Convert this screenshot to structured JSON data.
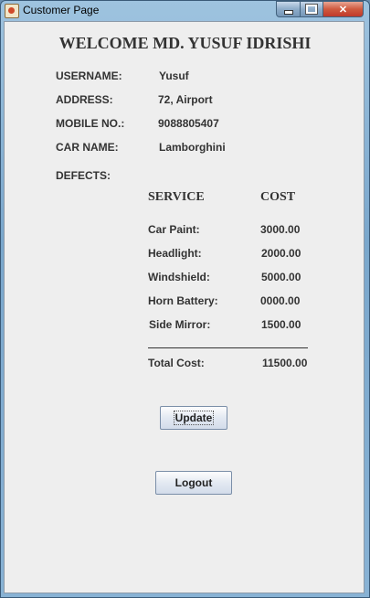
{
  "window": {
    "title": "Customer Page"
  },
  "heading": "WELCOME MD. YUSUF IDRISHI",
  "profile": {
    "username_label": "USERNAME:",
    "username": "Yusuf",
    "address_label": "ADDRESS:",
    "address": "72, Airport",
    "mobile_label": "MOBILE NO.:",
    "mobile": "9088805407",
    "car_label": "CAR NAME:",
    "car": "Lamborghini",
    "defects_label": "DEFECTS:"
  },
  "services": {
    "service_header": "SERVICE",
    "cost_header": "COST",
    "items": [
      {
        "name": "Car Paint:",
        "cost": "3000.00"
      },
      {
        "name": "Headlight:",
        "cost": "2000.00"
      },
      {
        "name": "Windshield:",
        "cost": "5000.00"
      },
      {
        "name": "Horn Battery:",
        "cost": "0000.00"
      },
      {
        "name": "Side Mirror:",
        "cost": "1500.00"
      }
    ],
    "total_label": "Total Cost:",
    "total": "11500.00"
  },
  "buttons": {
    "update": "Update",
    "logout": "Logout"
  }
}
